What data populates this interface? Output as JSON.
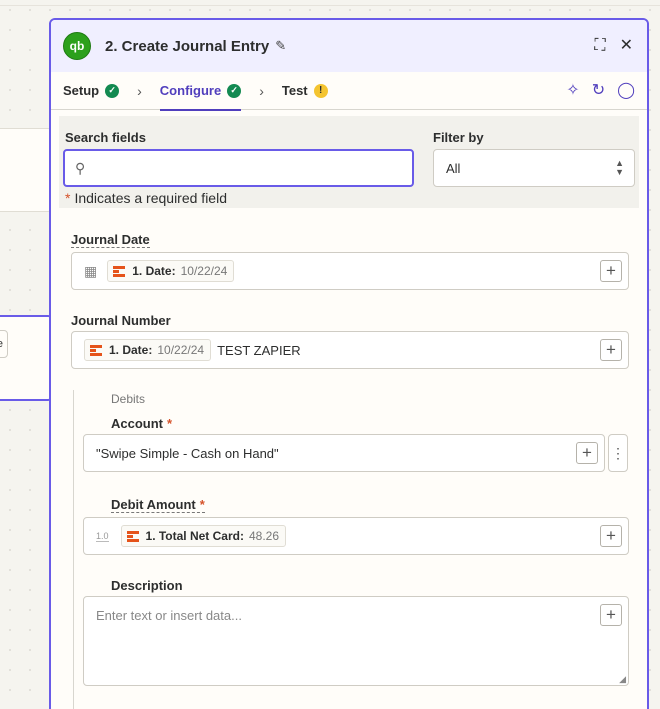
{
  "step": {
    "title": "2. Create Journal Entry",
    "app_logo": "qb"
  },
  "tabs": [
    {
      "label": "Setup",
      "status": "complete"
    },
    {
      "label": "Configure",
      "status": "complete"
    },
    {
      "label": "Test",
      "status": "warning"
    }
  ],
  "filter": {
    "search_label": "Search fields",
    "search_value": "",
    "filter_label": "Filter by",
    "filter_value": "All",
    "required_note": "Indicates a required field"
  },
  "fields": {
    "journal_date": {
      "label": "Journal Date",
      "pill_label": "1. Date:",
      "pill_value": "10/22/24"
    },
    "journal_number": {
      "label": "Journal Number",
      "pill_label": "1. Date:",
      "pill_value": "10/22/24",
      "text": "TEST ZAPIER"
    },
    "debits": {
      "group_title": "Debits",
      "account_label": "Account",
      "account_value": "\"Swipe Simple - Cash on Hand\"",
      "amount_label": "Debit Amount",
      "amount_pill_label": "1. Total Net Card:",
      "amount_pill_value": "48.26",
      "amount_type": "1.0",
      "description_label": "Description",
      "description_placeholder": "Enter text or insert data..."
    }
  },
  "background": {
    "chip_text": "e"
  },
  "colors": {
    "accent": "#695be8",
    "tab_active": "#503ebd",
    "check": "#138a51",
    "warning": "#f4c430",
    "required": "#d5522a",
    "quickbooks": "#2ca01c"
  }
}
